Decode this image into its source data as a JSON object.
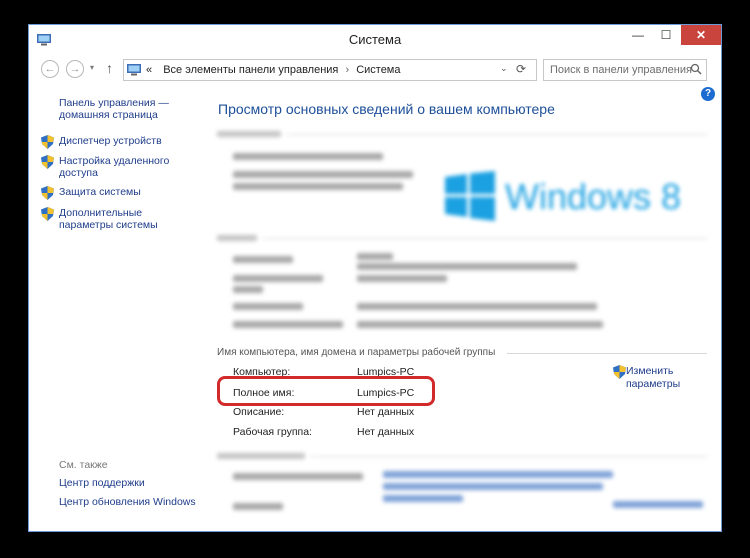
{
  "window": {
    "title": "Система",
    "min": "—",
    "max": "☐",
    "close": "✕"
  },
  "nav": {
    "back": "←",
    "forward": "→",
    "dropdown": "▾",
    "up": "↑",
    "breadcrumb": [
      "«",
      "Все элементы панели управления",
      "Система"
    ],
    "search_placeholder": "Поиск в панели управления",
    "refresh": "⟳",
    "addr_dropdown": "⌄"
  },
  "sidebar": {
    "home": "Панель управления — домашняя страница",
    "items": [
      {
        "label": "Диспетчер устройств"
      },
      {
        "label": "Настройка удаленного доступа"
      },
      {
        "label": "Защита системы"
      },
      {
        "label": "Дополнительные параметры системы"
      }
    ],
    "see_also": "См. также",
    "bottom_links": [
      "Центр поддержки",
      "Центр обновления Windows"
    ]
  },
  "main": {
    "title": "Просмотр основных сведений о вашем компьютере",
    "section_computer": "Имя компьютера, имя домена и параметры рабочей группы",
    "rows": [
      {
        "label": "Компьютер:",
        "value": "Lumpics-PC"
      },
      {
        "label": "Полное имя:",
        "value": "Lumpics-PC"
      },
      {
        "label": "Описание:",
        "value": "Нет данных"
      },
      {
        "label": "Рабочая группа:",
        "value": "Нет данных"
      }
    ],
    "change_link": "Изменить параметры",
    "windows_logo_text": "Windows 8"
  },
  "colors": {
    "link": "#1f3d8a",
    "title": "#1d4f99",
    "highlight": "#d22a2a",
    "close": "#c8443d",
    "win8": "#1ba1e2"
  }
}
